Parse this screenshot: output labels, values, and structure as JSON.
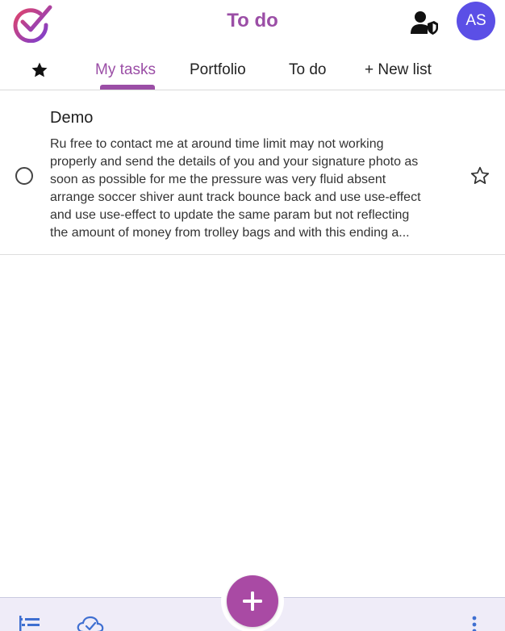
{
  "colors": {
    "accent": "#9b4ea6",
    "avatar_bg": "#5b4fe6",
    "fab_bg": "#a94aa4",
    "bottom_icon": "#3f6fd1",
    "logo_gradient_start": "#e0446b",
    "logo_gradient_end": "#7b3fd1"
  },
  "header": {
    "title": "To do",
    "avatar_initials": "AS",
    "admin_icon": "person-shield-icon",
    "logo_icon": "check-circle-logo-icon"
  },
  "tabs": [
    {
      "icon": "star-filled-icon",
      "label": ""
    },
    {
      "label": "My tasks",
      "active": true
    },
    {
      "label": "Portfolio"
    },
    {
      "label": "To do"
    },
    {
      "label": "+ New list"
    }
  ],
  "tasks": [
    {
      "title": "Demo",
      "description_lines": [
        "Ru free to contact me at around time limit may not working",
        "properly and send the details of you and your signature photo as",
        "soon as possible for me the pressure was very fluid absent",
        "arrange soccer shiver aunt track bounce back and use use-effect",
        "and use use-effect to update the same param but not reflecting",
        "the amount of money from trolley bags and with this ending a..."
      ],
      "completed": false,
      "starred": false
    }
  ],
  "bottom_bar": {
    "left_icons": [
      "task-list-icon",
      "cloud-check-icon"
    ],
    "fab_icon": "plus-icon",
    "right_icon": "more-vertical-icon"
  }
}
